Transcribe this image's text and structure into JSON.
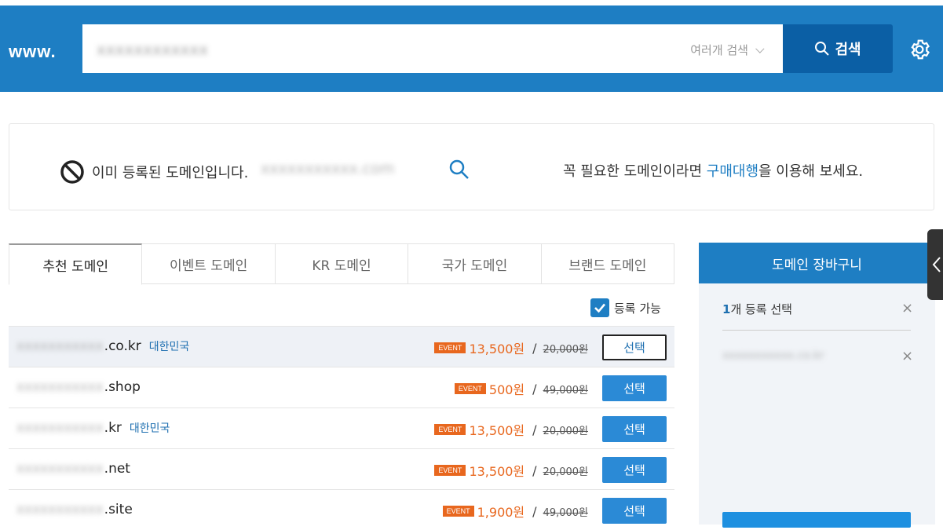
{
  "header": {
    "logo": "www.",
    "search_value": "xxxxxxxxxxxx",
    "multi_search_label": "여러개 검색",
    "search_button": "검색"
  },
  "notice": {
    "message": "이미 등록된 도메인입니다.",
    "domain": "xxxxxxxxxxx.com",
    "right_prefix": "꼭 필요한 도메인이라면 ",
    "right_link": "구매대행",
    "right_suffix": "을 이용해 보세요."
  },
  "tabs": [
    {
      "label": "추천 도메인"
    },
    {
      "label": "이벤트 도메인"
    },
    {
      "label": "KR 도메인"
    },
    {
      "label": "국가 도메인"
    },
    {
      "label": "브랜드 도메인"
    }
  ],
  "filter": {
    "label": "등록 가능",
    "checked": true
  },
  "results": [
    {
      "name": "xxxxxxxxxxx",
      "tld": ".co.kr",
      "country": "대한민국",
      "event": "EVENT",
      "price": "13,500원",
      "slash": "/",
      "original": "20,000원",
      "button": "선택"
    },
    {
      "name": "xxxxxxxxxxx",
      "tld": ".shop",
      "country": "",
      "event": "EVENT",
      "price": "500원",
      "slash": "/",
      "original": "49,000원",
      "button": "선택"
    },
    {
      "name": "xxxxxxxxxxx",
      "tld": ".kr",
      "country": "대한민국",
      "event": "EVENT",
      "price": "13,500원",
      "slash": "/",
      "original": "20,000원",
      "button": "선택"
    },
    {
      "name": "xxxxxxxxxxx",
      "tld": ".net",
      "country": "",
      "event": "EVENT",
      "price": "13,500원",
      "slash": "/",
      "original": "20,000원",
      "button": "선택"
    },
    {
      "name": "xxxxxxxxxxx",
      "tld": ".site",
      "country": "",
      "event": "EVENT",
      "price": "1,900원",
      "slash": "/",
      "original": "49,000원",
      "button": "선택"
    }
  ],
  "cart": {
    "title": "도메인 장바구니",
    "count_number": "1",
    "count_text": "개 등록 선택",
    "close": "×",
    "item": "xxxxxxxxxxx.co.kr",
    "item_close": "×"
  },
  "colors": {
    "header_bg": "#1e7ec3",
    "search_button_bg": "#0b5fa5",
    "event_orange": "#e8671e",
    "select_button": "#2b8ad6"
  }
}
